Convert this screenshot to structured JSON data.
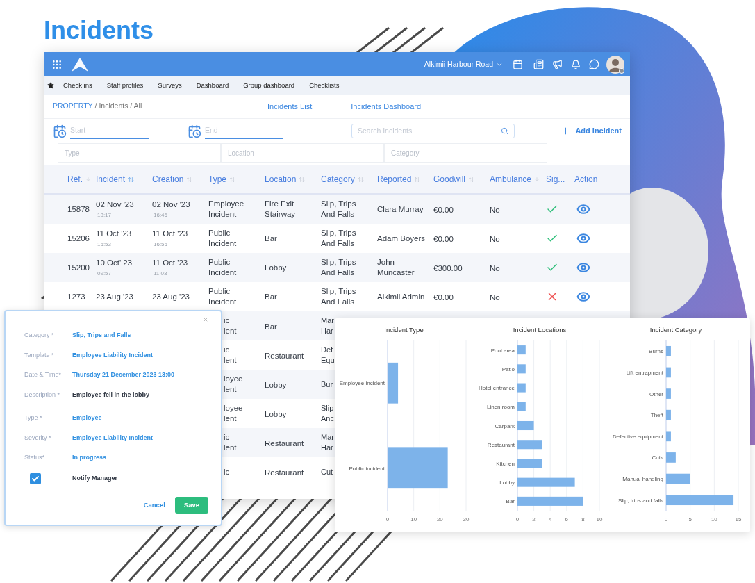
{
  "page_title": "Incidents",
  "topbar": {
    "property": "Alkimii Harbour Road"
  },
  "nav": [
    "Check ins",
    "Staff profiles",
    "Surveys",
    "Dashboard",
    "Group dashboard",
    "Checklists"
  ],
  "breadcrumb": {
    "root": "PROPERTY",
    "rest": "/ Incidents / All"
  },
  "tabs": [
    {
      "label": "Incidents List"
    },
    {
      "label": "Incidents Dashboard"
    }
  ],
  "filters": {
    "start_placeholder": "Start",
    "end_placeholder": "End",
    "search_placeholder": "Search Incidents",
    "add_button": "Add Incident",
    "selects": [
      "Type",
      "Location",
      "Category"
    ]
  },
  "table": {
    "columns": [
      {
        "label": "Ref.",
        "kind": "down",
        "sorted": false
      },
      {
        "label": "Incident",
        "kind": "updown",
        "sorted": true
      },
      {
        "label": "Creation",
        "kind": "updown",
        "sorted": false
      },
      {
        "label": "Type",
        "kind": "updown",
        "sorted": false
      },
      {
        "label": "Location",
        "kind": "updown",
        "sorted": false
      },
      {
        "label": "Category",
        "kind": "updown",
        "sorted": false
      },
      {
        "label": "Reported",
        "kind": "updown",
        "sorted": false
      },
      {
        "label": "Goodwill",
        "kind": "updown",
        "sorted": false
      },
      {
        "label": "Ambulance",
        "kind": "down",
        "sorted": false
      },
      {
        "label": "Sig...",
        "kind": "plain"
      },
      {
        "label": "Action",
        "kind": "plain"
      }
    ],
    "rows": [
      {
        "kind": "full",
        "ref": "15878",
        "incident": "02 Nov '23",
        "incident_time": "13:17",
        "creation": "02 Nov '23",
        "creation_time": "16:46",
        "type": "Employee Incident",
        "location": "Fire Exit Stairway",
        "category": "Slip, Trips And Falls",
        "reported": "Clara Murray",
        "goodwill": "€0.00",
        "ambulance": "No",
        "signed": true
      },
      {
        "kind": "full",
        "ref": "15206",
        "incident": "11 Oct '23",
        "incident_time": "15:53",
        "creation": "11 Oct '23",
        "creation_time": "16:55",
        "type": "Public Incident",
        "location": "Bar",
        "category": "Slip, Trips And Falls",
        "reported": "Adam Boyers",
        "goodwill": "€0.00",
        "ambulance": "No",
        "signed": true
      },
      {
        "kind": "full",
        "ref": "15200",
        "incident": "10 Oct' 23",
        "incident_time": "09:57",
        "creation": "11 Oct '23",
        "creation_time": "11:03",
        "type": "Public Incident",
        "location": "Lobby",
        "category": "Slip, Trips And Falls",
        "reported": "John Muncaster",
        "goodwill": "€300.00",
        "ambulance": "No",
        "signed": true
      },
      {
        "kind": "full",
        "ref": "1273",
        "incident": "23 Aug '23",
        "creation": "23 Aug '23",
        "type": "Public Incident",
        "location": "Bar",
        "category": "Slip, Trips And Falls",
        "reported": "Alkimii Admin",
        "goodwill": "€0.00",
        "ambulance": "No",
        "signed": false
      },
      {
        "kind": "partial",
        "type": "ic lent",
        "location": "Bar",
        "category": "Mar Har"
      },
      {
        "kind": "partial",
        "type": "ic lent",
        "location": "Restaurant",
        "category": "Def Equ"
      },
      {
        "kind": "partial",
        "type": "loyee lent",
        "location": "Lobby",
        "category": "Bur"
      },
      {
        "kind": "partial",
        "type": "loyee lent",
        "location": "Lobby",
        "category": "Slip Anc"
      },
      {
        "kind": "partial",
        "type": "ic lent",
        "location": "Restaurant",
        "category": "Mar Har"
      },
      {
        "kind": "partial",
        "type": "ic",
        "location": "Restaurant",
        "category": "Cut"
      }
    ]
  },
  "dialog": {
    "fields": [
      {
        "label": "Category *",
        "value": "Slip, Trips and Falls",
        "kind": "select"
      },
      {
        "label": "Template *",
        "value": "Employee Liability Incident",
        "kind": "select"
      },
      {
        "label": "Date & Time*",
        "value": "Thursday 21 December 2023 13:00",
        "kind": "select"
      },
      {
        "label": "Description *",
        "value": "Employee fell in the lobby",
        "kind": "text"
      },
      {
        "label": "Type *",
        "value": "Employee",
        "kind": "select"
      },
      {
        "label": "Severity *",
        "value": "Employee Liability Incident",
        "kind": "select"
      },
      {
        "label": "Status*",
        "value": "In progress",
        "kind": "select"
      }
    ],
    "notify": {
      "label": "Notify Manager",
      "checked": true
    },
    "cancel": "Cancel",
    "save": "Save"
  },
  "charts": [
    {
      "chart_data": {
        "type": "bar",
        "orientation": "horizontal",
        "title": "Incident Type",
        "categories": [
          "Employee incident",
          "Public incident"
        ],
        "series": [
          {
            "color": "#7db3ea",
            "values": [
              4,
              23
            ]
          }
        ],
        "xlim": [
          0,
          30
        ],
        "xticks": [
          0,
          10,
          20,
          30
        ],
        "grid": true
      }
    },
    {
      "chart_data": {
        "type": "bar",
        "orientation": "horizontal",
        "title": "Incident Locations",
        "categories": [
          "Pool area",
          "Patio",
          "Hotel entrance",
          "Linen room",
          "Carpark",
          "Restaurant",
          "Kitchen",
          "Lobby",
          "Bar"
        ],
        "series": [
          {
            "color": "#7db3ea",
            "values": [
              1,
              1,
              1,
              1,
              2,
              3,
              3,
              7,
              8
            ]
          }
        ],
        "xlim": [
          0,
          10
        ],
        "xticks": [
          0,
          2,
          4,
          6,
          8,
          10
        ],
        "grid": true
      }
    },
    {
      "chart_data": {
        "type": "bar",
        "orientation": "horizontal",
        "title": "Incident Category",
        "categories": [
          "Burns",
          "Lift entrapment",
          "Other",
          "Theft",
          "Defective equipment",
          "Cuts",
          "Manual handling",
          "Slip, trips and falls"
        ],
        "series": [
          {
            "color": "#7db3ea",
            "values": [
              1,
              1,
              1,
              1,
              1,
              2,
              5,
              14
            ]
          }
        ],
        "xlim": [
          0,
          15
        ],
        "xticks": [
          0,
          5,
          10,
          15
        ],
        "grid": true
      }
    }
  ]
}
